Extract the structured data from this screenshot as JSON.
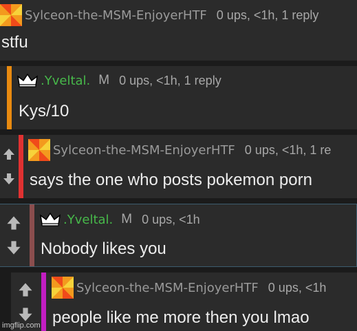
{
  "comments": [
    {
      "username": "Sylceon-the-MSM-EnjoyerHTF",
      "flair": "",
      "meta": "0 ups, <1h, 1 reply",
      "text": "stfu",
      "bar_color": ""
    },
    {
      "username": ".Yveltal.",
      "flair": "M",
      "meta": "0 ups, <1h, 1 reply",
      "text": "Kys/10",
      "bar_color": "#e88a10"
    },
    {
      "username": "Sylceon-the-MSM-EnjoyerHTF",
      "flair": "",
      "meta": "0 ups, <1h, 1 re",
      "text": "says the one who posts pokemon porn",
      "bar_color": "#e03131"
    },
    {
      "username": ".Yveltal.",
      "flair": "M",
      "meta": "0 ups, <1h",
      "text": "Nobody likes you",
      "bar_color": "#8b4e4e"
    },
    {
      "username": "Sylceon-the-MSM-EnjoyerHTF",
      "flair": "",
      "meta": "0 ups, <1h",
      "text": "people like me more then you lmao",
      "bar_color": "#c21ec2"
    }
  ],
  "icons": {
    "avatar": "orange-pinwheel-avatar-icon",
    "crown": "crown-icon",
    "upvote": "upvote-arrow-icon",
    "downvote": "downvote-arrow-icon"
  },
  "colors": {
    "username_green": "#47b84a",
    "username_gray": "#9a9a9a"
  },
  "watermark": "imgflip.com"
}
